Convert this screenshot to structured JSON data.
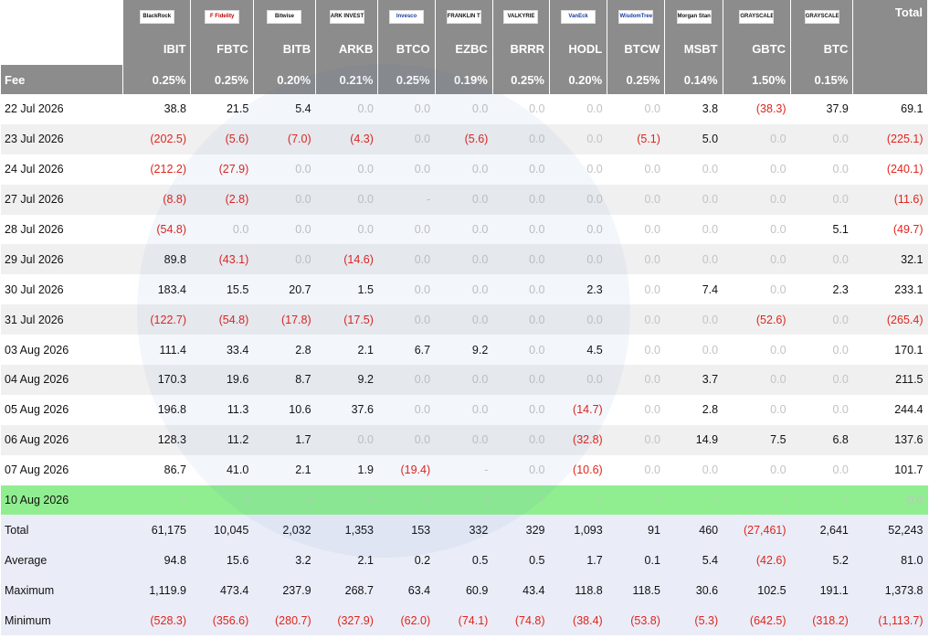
{
  "logos": [
    {
      "name": "blackrock-logo",
      "text": "BlackRock",
      "style": "dark"
    },
    {
      "name": "fidelity-logo",
      "text": "F Fidelity",
      "style": "red"
    },
    {
      "name": "bitwise-logo",
      "text": "Bitwise",
      "style": "dark"
    },
    {
      "name": "ark-logo",
      "text": "ARK INVEST",
      "style": "dark"
    },
    {
      "name": "invesco-logo",
      "text": "Invesco",
      "style": "blue"
    },
    {
      "name": "franklin-logo",
      "text": "FRANKLIN TEMPLETON",
      "style": "dark"
    },
    {
      "name": "valkyrie-logo",
      "text": "VALKYRIE",
      "style": "dark"
    },
    {
      "name": "vaneck-logo",
      "text": "VanEck",
      "style": "blue"
    },
    {
      "name": "wisdomtree-logo",
      "text": "WisdomTree",
      "style": "blue"
    },
    {
      "name": "morgan-stanley-logo",
      "text": "Morgan Stanley",
      "style": "dark"
    },
    {
      "name": "grayscale-logo-1",
      "text": "GRAYSCALE",
      "style": "dark"
    },
    {
      "name": "grayscale-logo-2",
      "text": "GRAYSCALE",
      "style": "dark"
    }
  ],
  "header": {
    "total_label": "Total",
    "tickers": [
      "IBIT",
      "FBTC",
      "BITB",
      "ARKB",
      "BTCO",
      "EZBC",
      "BRRR",
      "HODL",
      "BTCW",
      "MSBT",
      "GBTC",
      "BTC"
    ],
    "fee_label": "Fee",
    "fees": [
      "0.25%",
      "0.25%",
      "0.20%",
      "0.21%",
      "0.25%",
      "0.19%",
      "0.25%",
      "0.20%",
      "0.25%",
      "0.14%",
      "1.50%",
      "0.15%"
    ]
  },
  "rows": [
    {
      "date": "22 Jul 2026",
      "cells": [
        "38.8",
        "21.5",
        "5.4",
        "0.0",
        "0.0",
        "0.0",
        "0.0",
        "0.0",
        "0.0",
        "3.8",
        "(38.3)",
        "37.9",
        "69.1"
      ]
    },
    {
      "date": "23 Jul 2026",
      "cells": [
        "(202.5)",
        "(5.6)",
        "(7.0)",
        "(4.3)",
        "0.0",
        "(5.6)",
        "0.0",
        "0.0",
        "(5.1)",
        "5.0",
        "0.0",
        "0.0",
        "(225.1)"
      ]
    },
    {
      "date": "24 Jul 2026",
      "cells": [
        "(212.2)",
        "(27.9)",
        "0.0",
        "0.0",
        "0.0",
        "0.0",
        "0.0",
        "0.0",
        "0.0",
        "0.0",
        "0.0",
        "0.0",
        "(240.1)"
      ]
    },
    {
      "date": "27 Jul 2026",
      "cells": [
        "(8.8)",
        "(2.8)",
        "0.0",
        "0.0",
        "-",
        "0.0",
        "0.0",
        "0.0",
        "0.0",
        "0.0",
        "0.0",
        "0.0",
        "(11.6)"
      ]
    },
    {
      "date": "28 Jul 2026",
      "cells": [
        "(54.8)",
        "0.0",
        "0.0",
        "0.0",
        "0.0",
        "0.0",
        "0.0",
        "0.0",
        "0.0",
        "0.0",
        "0.0",
        "5.1",
        "(49.7)"
      ]
    },
    {
      "date": "29 Jul 2026",
      "cells": [
        "89.8",
        "(43.1)",
        "0.0",
        "(14.6)",
        "0.0",
        "0.0",
        "0.0",
        "0.0",
        "0.0",
        "0.0",
        "0.0",
        "0.0",
        "32.1"
      ]
    },
    {
      "date": "30 Jul 2026",
      "cells": [
        "183.4",
        "15.5",
        "20.7",
        "1.5",
        "0.0",
        "0.0",
        "0.0",
        "2.3",
        "0.0",
        "7.4",
        "0.0",
        "2.3",
        "233.1"
      ]
    },
    {
      "date": "31 Jul 2026",
      "cells": [
        "(122.7)",
        "(54.8)",
        "(17.8)",
        "(17.5)",
        "0.0",
        "0.0",
        "0.0",
        "0.0",
        "0.0",
        "0.0",
        "(52.6)",
        "0.0",
        "(265.4)"
      ]
    },
    {
      "date": "03 Aug 2026",
      "cells": [
        "111.4",
        "33.4",
        "2.8",
        "2.1",
        "6.7",
        "9.2",
        "0.0",
        "4.5",
        "0.0",
        "0.0",
        "0.0",
        "0.0",
        "170.1"
      ]
    },
    {
      "date": "04 Aug 2026",
      "cells": [
        "170.3",
        "19.6",
        "8.7",
        "9.2",
        "0.0",
        "0.0",
        "0.0",
        "0.0",
        "0.0",
        "3.7",
        "0.0",
        "0.0",
        "211.5"
      ]
    },
    {
      "date": "05 Aug 2026",
      "cells": [
        "196.8",
        "11.3",
        "10.6",
        "37.6",
        "0.0",
        "0.0",
        "0.0",
        "(14.7)",
        "0.0",
        "2.8",
        "0.0",
        "0.0",
        "244.4"
      ]
    },
    {
      "date": "06 Aug 2026",
      "cells": [
        "128.3",
        "11.2",
        "1.7",
        "0.0",
        "0.0",
        "0.0",
        "0.0",
        "(32.8)",
        "0.0",
        "14.9",
        "7.5",
        "6.8",
        "137.6"
      ]
    },
    {
      "date": "07 Aug 2026",
      "cells": [
        "86.7",
        "41.0",
        "2.1",
        "1.9",
        "(19.4)",
        "-",
        "0.0",
        "(10.6)",
        "0.0",
        "0.0",
        "0.0",
        "0.0",
        "101.7"
      ]
    },
    {
      "date": "10 Aug 2026",
      "highlight": true,
      "cells": [
        "-",
        "-",
        "-",
        "-",
        "-",
        "-",
        "-",
        "-",
        "-",
        "-",
        "-",
        "-",
        "0.0"
      ]
    }
  ],
  "summary": [
    {
      "label": "Total",
      "cells": [
        "61,175",
        "10,045",
        "2,032",
        "1,353",
        "153",
        "332",
        "329",
        "1,093",
        "91",
        "460",
        "(27,461)",
        "2,641",
        "52,243"
      ]
    },
    {
      "label": "Average",
      "cells": [
        "94.8",
        "15.6",
        "3.2",
        "2.1",
        "0.2",
        "0.5",
        "0.5",
        "1.7",
        "0.1",
        "5.4",
        "(42.6)",
        "5.2",
        "81.0"
      ]
    },
    {
      "label": "Maximum",
      "cells": [
        "1,119.9",
        "473.4",
        "237.9",
        "268.7",
        "63.4",
        "60.9",
        "43.4",
        "118.8",
        "118.5",
        "30.6",
        "102.5",
        "191.1",
        "1,373.8"
      ]
    },
    {
      "label": "Minimum",
      "cells": [
        "(528.3)",
        "(356.6)",
        "(280.7)",
        "(327.9)",
        "(62.0)",
        "(74.1)",
        "(74.8)",
        "(38.4)",
        "(53.8)",
        "(5.3)",
        "(642.5)",
        "(318.2)",
        "(1,113.7)"
      ]
    }
  ],
  "colors": {
    "negative": "#e0241c",
    "zero": "#c3c3c3",
    "header_bg": "#8c8c8c",
    "highlight": "#90ee90",
    "summary_bg": "#eaedf7"
  }
}
